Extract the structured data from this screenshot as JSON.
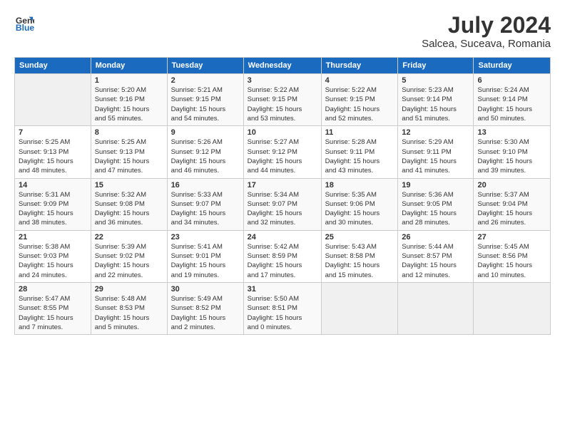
{
  "header": {
    "logo_line1": "General",
    "logo_line2": "Blue",
    "title": "July 2024",
    "subtitle": "Salcea, Suceava, Romania"
  },
  "days_of_week": [
    "Sunday",
    "Monday",
    "Tuesday",
    "Wednesday",
    "Thursday",
    "Friday",
    "Saturday"
  ],
  "weeks": [
    [
      {
        "day": "",
        "info": ""
      },
      {
        "day": "1",
        "info": "Sunrise: 5:20 AM\nSunset: 9:16 PM\nDaylight: 15 hours\nand 55 minutes."
      },
      {
        "day": "2",
        "info": "Sunrise: 5:21 AM\nSunset: 9:15 PM\nDaylight: 15 hours\nand 54 minutes."
      },
      {
        "day": "3",
        "info": "Sunrise: 5:22 AM\nSunset: 9:15 PM\nDaylight: 15 hours\nand 53 minutes."
      },
      {
        "day": "4",
        "info": "Sunrise: 5:22 AM\nSunset: 9:15 PM\nDaylight: 15 hours\nand 52 minutes."
      },
      {
        "day": "5",
        "info": "Sunrise: 5:23 AM\nSunset: 9:14 PM\nDaylight: 15 hours\nand 51 minutes."
      },
      {
        "day": "6",
        "info": "Sunrise: 5:24 AM\nSunset: 9:14 PM\nDaylight: 15 hours\nand 50 minutes."
      }
    ],
    [
      {
        "day": "7",
        "info": "Sunrise: 5:25 AM\nSunset: 9:13 PM\nDaylight: 15 hours\nand 48 minutes."
      },
      {
        "day": "8",
        "info": "Sunrise: 5:25 AM\nSunset: 9:13 PM\nDaylight: 15 hours\nand 47 minutes."
      },
      {
        "day": "9",
        "info": "Sunrise: 5:26 AM\nSunset: 9:12 PM\nDaylight: 15 hours\nand 46 minutes."
      },
      {
        "day": "10",
        "info": "Sunrise: 5:27 AM\nSunset: 9:12 PM\nDaylight: 15 hours\nand 44 minutes."
      },
      {
        "day": "11",
        "info": "Sunrise: 5:28 AM\nSunset: 9:11 PM\nDaylight: 15 hours\nand 43 minutes."
      },
      {
        "day": "12",
        "info": "Sunrise: 5:29 AM\nSunset: 9:11 PM\nDaylight: 15 hours\nand 41 minutes."
      },
      {
        "day": "13",
        "info": "Sunrise: 5:30 AM\nSunset: 9:10 PM\nDaylight: 15 hours\nand 39 minutes."
      }
    ],
    [
      {
        "day": "14",
        "info": "Sunrise: 5:31 AM\nSunset: 9:09 PM\nDaylight: 15 hours\nand 38 minutes."
      },
      {
        "day": "15",
        "info": "Sunrise: 5:32 AM\nSunset: 9:08 PM\nDaylight: 15 hours\nand 36 minutes."
      },
      {
        "day": "16",
        "info": "Sunrise: 5:33 AM\nSunset: 9:07 PM\nDaylight: 15 hours\nand 34 minutes."
      },
      {
        "day": "17",
        "info": "Sunrise: 5:34 AM\nSunset: 9:07 PM\nDaylight: 15 hours\nand 32 minutes."
      },
      {
        "day": "18",
        "info": "Sunrise: 5:35 AM\nSunset: 9:06 PM\nDaylight: 15 hours\nand 30 minutes."
      },
      {
        "day": "19",
        "info": "Sunrise: 5:36 AM\nSunset: 9:05 PM\nDaylight: 15 hours\nand 28 minutes."
      },
      {
        "day": "20",
        "info": "Sunrise: 5:37 AM\nSunset: 9:04 PM\nDaylight: 15 hours\nand 26 minutes."
      }
    ],
    [
      {
        "day": "21",
        "info": "Sunrise: 5:38 AM\nSunset: 9:03 PM\nDaylight: 15 hours\nand 24 minutes."
      },
      {
        "day": "22",
        "info": "Sunrise: 5:39 AM\nSunset: 9:02 PM\nDaylight: 15 hours\nand 22 minutes."
      },
      {
        "day": "23",
        "info": "Sunrise: 5:41 AM\nSunset: 9:01 PM\nDaylight: 15 hours\nand 19 minutes."
      },
      {
        "day": "24",
        "info": "Sunrise: 5:42 AM\nSunset: 8:59 PM\nDaylight: 15 hours\nand 17 minutes."
      },
      {
        "day": "25",
        "info": "Sunrise: 5:43 AM\nSunset: 8:58 PM\nDaylight: 15 hours\nand 15 minutes."
      },
      {
        "day": "26",
        "info": "Sunrise: 5:44 AM\nSunset: 8:57 PM\nDaylight: 15 hours\nand 12 minutes."
      },
      {
        "day": "27",
        "info": "Sunrise: 5:45 AM\nSunset: 8:56 PM\nDaylight: 15 hours\nand 10 minutes."
      }
    ],
    [
      {
        "day": "28",
        "info": "Sunrise: 5:47 AM\nSunset: 8:55 PM\nDaylight: 15 hours\nand 7 minutes."
      },
      {
        "day": "29",
        "info": "Sunrise: 5:48 AM\nSunset: 8:53 PM\nDaylight: 15 hours\nand 5 minutes."
      },
      {
        "day": "30",
        "info": "Sunrise: 5:49 AM\nSunset: 8:52 PM\nDaylight: 15 hours\nand 2 minutes."
      },
      {
        "day": "31",
        "info": "Sunrise: 5:50 AM\nSunset: 8:51 PM\nDaylight: 15 hours\nand 0 minutes."
      },
      {
        "day": "",
        "info": ""
      },
      {
        "day": "",
        "info": ""
      },
      {
        "day": "",
        "info": ""
      }
    ]
  ]
}
